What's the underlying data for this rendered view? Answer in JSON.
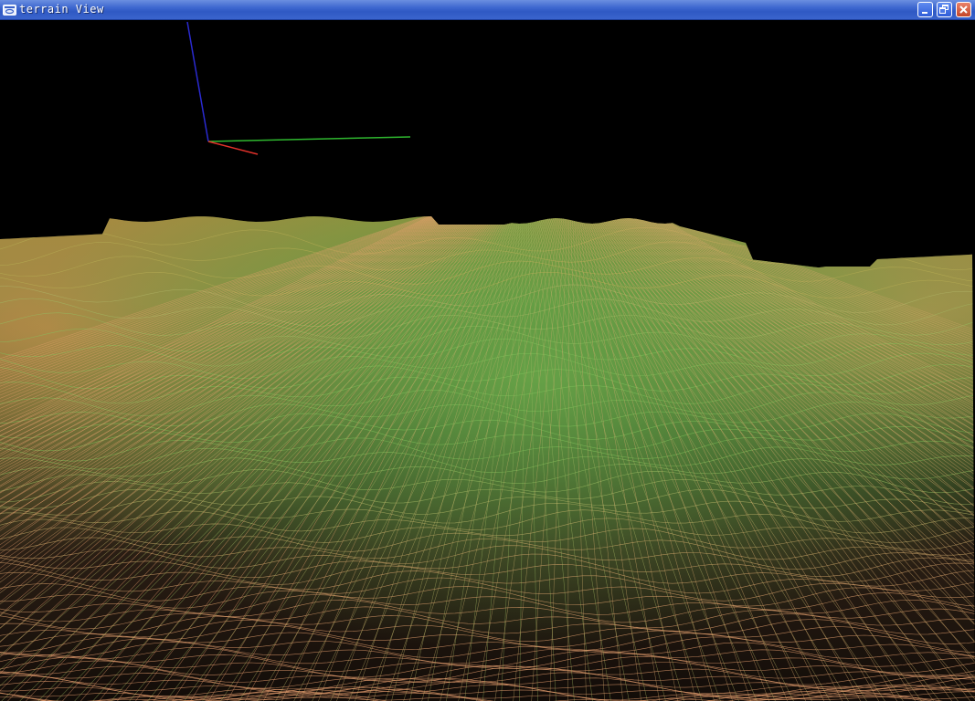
{
  "window": {
    "title": "terrain View",
    "icon": "app-window-icon",
    "controls": {
      "minimize_icon": "minimize-icon",
      "maximize_icon": "restore-icon",
      "close_icon": "close-icon"
    }
  },
  "scene": {
    "background_color": "#000000",
    "axes": {
      "x_color": "#e0312a",
      "y_color": "#2fb82f",
      "z_color": "#2a2ad0"
    },
    "terrain": {
      "render_mode": "wireframe",
      "low_color": "#e9a070",
      "mid_color": "#7fbf5a",
      "high_color": "#c8a450"
    }
  }
}
